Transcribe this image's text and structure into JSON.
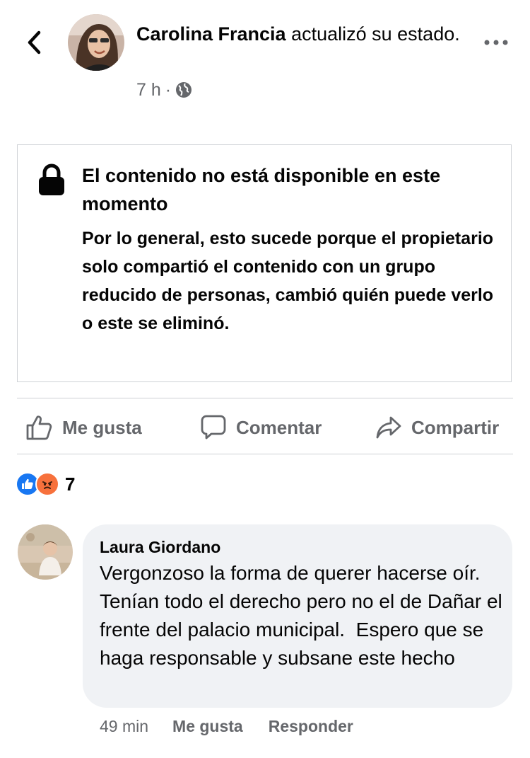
{
  "post": {
    "author": "Carolina Francia",
    "action_text": " actualizó su estado.",
    "time": "7 h",
    "separator": "·",
    "audience_icon": "globe-icon"
  },
  "unavailable": {
    "title": "El contenido no está disponible en este momento",
    "body": "Por lo general, esto sucede porque el propietario solo compartió el contenido con un grupo reducido de personas, cambió quién puede verlo o este se eliminó."
  },
  "actions": {
    "like": "Me gusta",
    "comment": "Comentar",
    "share": "Compartir"
  },
  "reactions": {
    "types": [
      "like",
      "angry"
    ],
    "count": "7",
    "colors": {
      "like": "#1877f2",
      "angry": "#f7713c"
    }
  },
  "comment": {
    "author": "Laura Giordano",
    "text": "Vergonzoso la forma de querer hacerse oír. Tenían todo el derecho pero no el de Dañar el frente del palacio municipal.  Espero que se haga responsable y subsane este hecho",
    "time": "49 min",
    "like_label": "Me gusta",
    "reply_label": "Responder"
  }
}
